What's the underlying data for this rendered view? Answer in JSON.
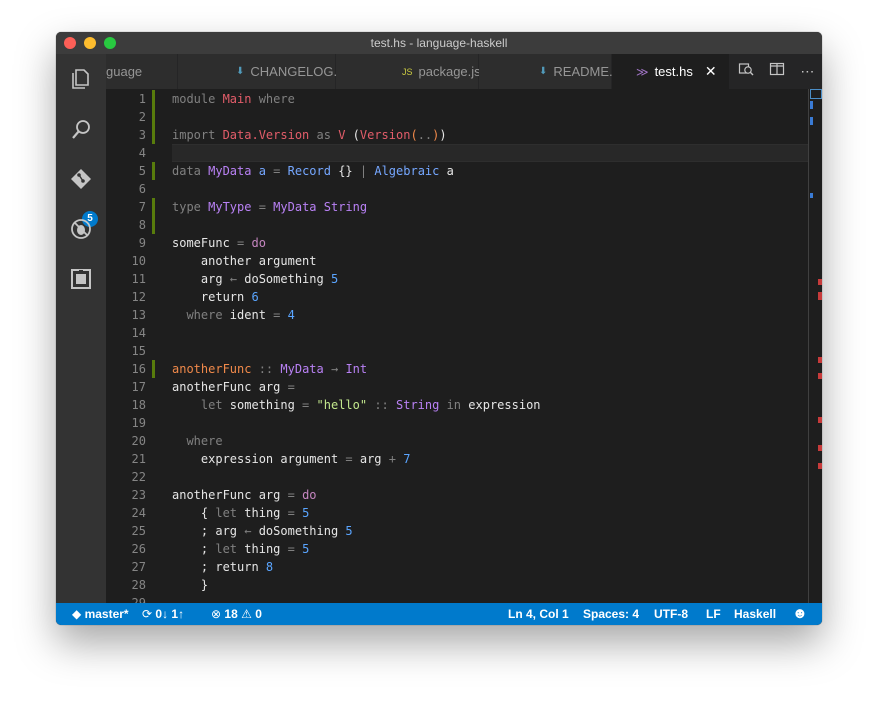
{
  "window": {
    "title": "test.hs - language-haskell"
  },
  "activity": {
    "items": [
      {
        "name": "explorer",
        "icon": "files-icon"
      },
      {
        "name": "search",
        "icon": "search-icon"
      },
      {
        "name": "scm",
        "icon": "git-icon"
      },
      {
        "name": "debug",
        "icon": "bug-icon"
      },
      {
        "name": "extensions",
        "icon": "extensions-icon"
      }
    ],
    "scm_badge": "5"
  },
  "tabs": [
    {
      "label": "guage",
      "icon": ""
    },
    {
      "label": "CHANGELOG.md",
      "icon": "download-icon"
    },
    {
      "label": "package.json",
      "icon": "JS"
    },
    {
      "label": "README.md",
      "icon": "download-icon"
    },
    {
      "label": "test.hs",
      "icon": "haskell-icon",
      "active": true
    }
  ],
  "editor": {
    "current_line": 4,
    "modified_lines": [
      1,
      2,
      3,
      5,
      7,
      8,
      16
    ],
    "lines": [
      {
        "n": "1",
        "t": [
          [
            "kw",
            "module "
          ],
          [
            "con",
            "Main"
          ],
          [
            "kw",
            " where"
          ]
        ]
      },
      {
        "n": "2",
        "t": []
      },
      {
        "n": "3",
        "t": [
          [
            "kw",
            "import "
          ],
          [
            "con",
            "Data.Version"
          ],
          [
            "kw",
            " as "
          ],
          [
            "con",
            "V"
          ],
          [
            "id",
            " ("
          ],
          [
            "con",
            "Version"
          ],
          [
            "paren",
            "("
          ],
          [
            "op",
            ".."
          ],
          [
            "paren",
            ")"
          ],
          [
            "id",
            ")"
          ]
        ]
      },
      {
        "n": "4",
        "t": []
      },
      {
        "n": "5",
        "t": [
          [
            "kw",
            "data "
          ],
          [
            "type",
            "MyData"
          ],
          [
            "rec",
            " a"
          ],
          [
            "op",
            " = "
          ],
          [
            "rec",
            "Record"
          ],
          [
            "id",
            " {}"
          ],
          [
            "op",
            " | "
          ],
          [
            "rec",
            "Algebraic"
          ],
          [
            "id",
            " a"
          ]
        ]
      },
      {
        "n": "6",
        "t": []
      },
      {
        "n": "7",
        "t": [
          [
            "kw",
            "type "
          ],
          [
            "type",
            "MyType"
          ],
          [
            "op",
            " = "
          ],
          [
            "type",
            "MyData String"
          ]
        ]
      },
      {
        "n": "8",
        "t": []
      },
      {
        "n": "9",
        "t": [
          [
            "id",
            "someFunc"
          ],
          [
            "op",
            " = "
          ],
          [
            "kw2",
            "do"
          ]
        ]
      },
      {
        "n": "10",
        "t": [
          [
            "id",
            "    another argument"
          ]
        ]
      },
      {
        "n": "11",
        "t": [
          [
            "id",
            "    arg "
          ],
          [
            "op",
            "←"
          ],
          [
            "id",
            " doSomething "
          ],
          [
            "num",
            "5"
          ]
        ]
      },
      {
        "n": "12",
        "t": [
          [
            "id",
            "    return "
          ],
          [
            "num",
            "6"
          ]
        ]
      },
      {
        "n": "13",
        "t": [
          [
            "kw",
            "  where"
          ],
          [
            "id",
            " ident"
          ],
          [
            "op",
            " = "
          ],
          [
            "num",
            "4"
          ]
        ]
      },
      {
        "n": "14",
        "t": []
      },
      {
        "n": "15",
        "t": []
      },
      {
        "n": "16",
        "t": [
          [
            "fn",
            "anotherFunc"
          ],
          [
            "op",
            " :: "
          ],
          [
            "type",
            "MyData"
          ],
          [
            "op",
            " → "
          ],
          [
            "type",
            "Int"
          ]
        ]
      },
      {
        "n": "17",
        "t": [
          [
            "id",
            "anotherFunc arg"
          ],
          [
            "op",
            " ="
          ]
        ]
      },
      {
        "n": "18",
        "t": [
          [
            "kw",
            "    let"
          ],
          [
            "id",
            " something"
          ],
          [
            "op",
            " = "
          ],
          [
            "str",
            "\"hello\""
          ],
          [
            "op",
            " :: "
          ],
          [
            "type",
            "String"
          ],
          [
            "kw",
            " in"
          ],
          [
            "id",
            " expression"
          ]
        ]
      },
      {
        "n": "19",
        "t": []
      },
      {
        "n": "20",
        "t": [
          [
            "kw",
            "  where"
          ]
        ]
      },
      {
        "n": "21",
        "t": [
          [
            "id",
            "    expression argument"
          ],
          [
            "op",
            " = "
          ],
          [
            "id",
            "arg"
          ],
          [
            "op",
            " + "
          ],
          [
            "num",
            "7"
          ]
        ]
      },
      {
        "n": "22",
        "t": []
      },
      {
        "n": "23",
        "t": [
          [
            "id",
            "anotherFunc arg"
          ],
          [
            "op",
            " = "
          ],
          [
            "kw2",
            "do"
          ]
        ]
      },
      {
        "n": "24",
        "t": [
          [
            "id",
            "    { "
          ],
          [
            "kw",
            "let"
          ],
          [
            "id",
            " thing"
          ],
          [
            "op",
            " = "
          ],
          [
            "num",
            "5"
          ]
        ]
      },
      {
        "n": "25",
        "t": [
          [
            "id",
            "    ; arg "
          ],
          [
            "op",
            "←"
          ],
          [
            "id",
            " doSomething "
          ],
          [
            "num",
            "5"
          ]
        ]
      },
      {
        "n": "26",
        "t": [
          [
            "id",
            "    ; "
          ],
          [
            "kw",
            "let"
          ],
          [
            "id",
            " thing"
          ],
          [
            "op",
            " = "
          ],
          [
            "num",
            "5"
          ]
        ]
      },
      {
        "n": "27",
        "t": [
          [
            "id",
            "    ; return "
          ],
          [
            "num",
            "8"
          ]
        ]
      },
      {
        "n": "28",
        "t": [
          [
            "id",
            "    }"
          ]
        ]
      },
      {
        "n": "29",
        "t": []
      }
    ]
  },
  "status": {
    "branch": "master*",
    "sync": "0↓ 1↑",
    "errors": "18",
    "warnings": "0",
    "position": "Ln 4, Col 1",
    "indent": "Spaces: 4",
    "encoding": "UTF-8",
    "eol": "LF",
    "language": "Haskell"
  },
  "colors": {
    "statusbar": "#007acc",
    "titlebar": "#3c3c3c",
    "editor": "#1e1e1e",
    "modified_gutter": "#587c0c"
  }
}
